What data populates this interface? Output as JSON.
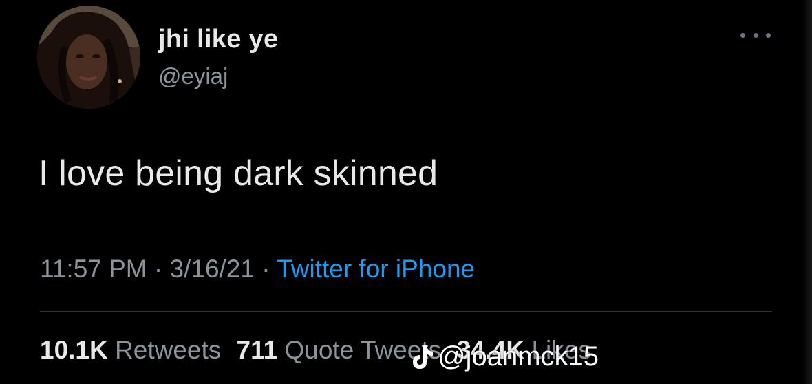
{
  "user": {
    "display_name": "jhi like ye",
    "handle": "@eyiaj"
  },
  "tweet": {
    "text": "I love being dark skinned",
    "time": "11:57 PM",
    "date": "3/16/21",
    "source": "Twitter for iPhone",
    "separator": " · "
  },
  "stats": {
    "retweets_count": "10.1K",
    "retweets_label": "Retweets",
    "quotes_count": "711",
    "quotes_label": "Quote Tweets",
    "likes_count": "34.4K",
    "likes_label": "Likes"
  },
  "watermark": {
    "icon": "tiktok-icon",
    "text": "@joanmck15"
  },
  "colors": {
    "background": "#000000",
    "primary_text": "#e7e9ea",
    "secondary_text": "#8b939b",
    "link": "#1d9bf0",
    "divider": "#2f3336"
  }
}
